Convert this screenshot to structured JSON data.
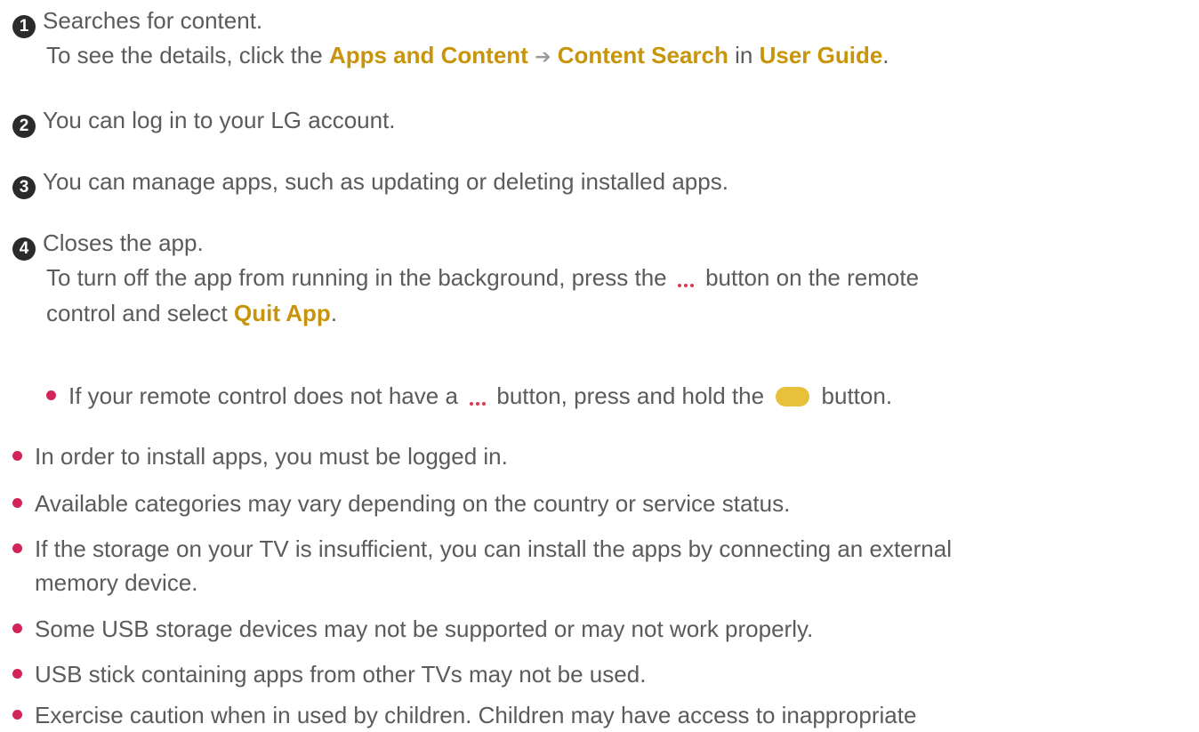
{
  "steps": [
    {
      "num": "1",
      "main": "Searches for content.",
      "detail": {
        "pre": "To see the details, click the ",
        "link1": "Apps and Content",
        "link2": "Content Search",
        "mid": " in ",
        "link3": "User Guide",
        "end": "."
      }
    },
    {
      "num": "2",
      "main": "You can log in to your LG account."
    },
    {
      "num": "3",
      "main": "You can manage apps, such as updating or deleting installed apps."
    },
    {
      "num": "4",
      "main": "Closes the app.",
      "detail_line1": "To turn off the app from running in the background, press the",
      "detail_line1_post": "button on the remote",
      "detail_line2_pre": "control and select ",
      "detail_line2_link": "Quit App",
      "detail_line2_end": ".",
      "sub_note": {
        "pre": "If your remote control does not have a",
        "mid": "button, press and hold the",
        "end": "button."
      }
    }
  ],
  "notes": [
    "In order to install apps, you must be logged in.",
    "Available categories may vary depending on the country or service status.",
    "If the storage on your TV is insufficient, you can install the apps by connecting an external",
    "memory device.",
    "Some USB storage devices may not be supported or may not work properly.",
    "USB stick containing apps from other TVs may not be used.",
    "Exercise caution when in used by children. Children may have access to inappropriate"
  ],
  "colors": {
    "link": "#c8940a",
    "bullet": "#d1255a",
    "dots": "#e0374f",
    "yellow_button": "#e8c13b"
  },
  "icons": {
    "arrow": "➔",
    "more_button": "three-dots-icon",
    "yellow_button": "yellow-button-icon"
  }
}
